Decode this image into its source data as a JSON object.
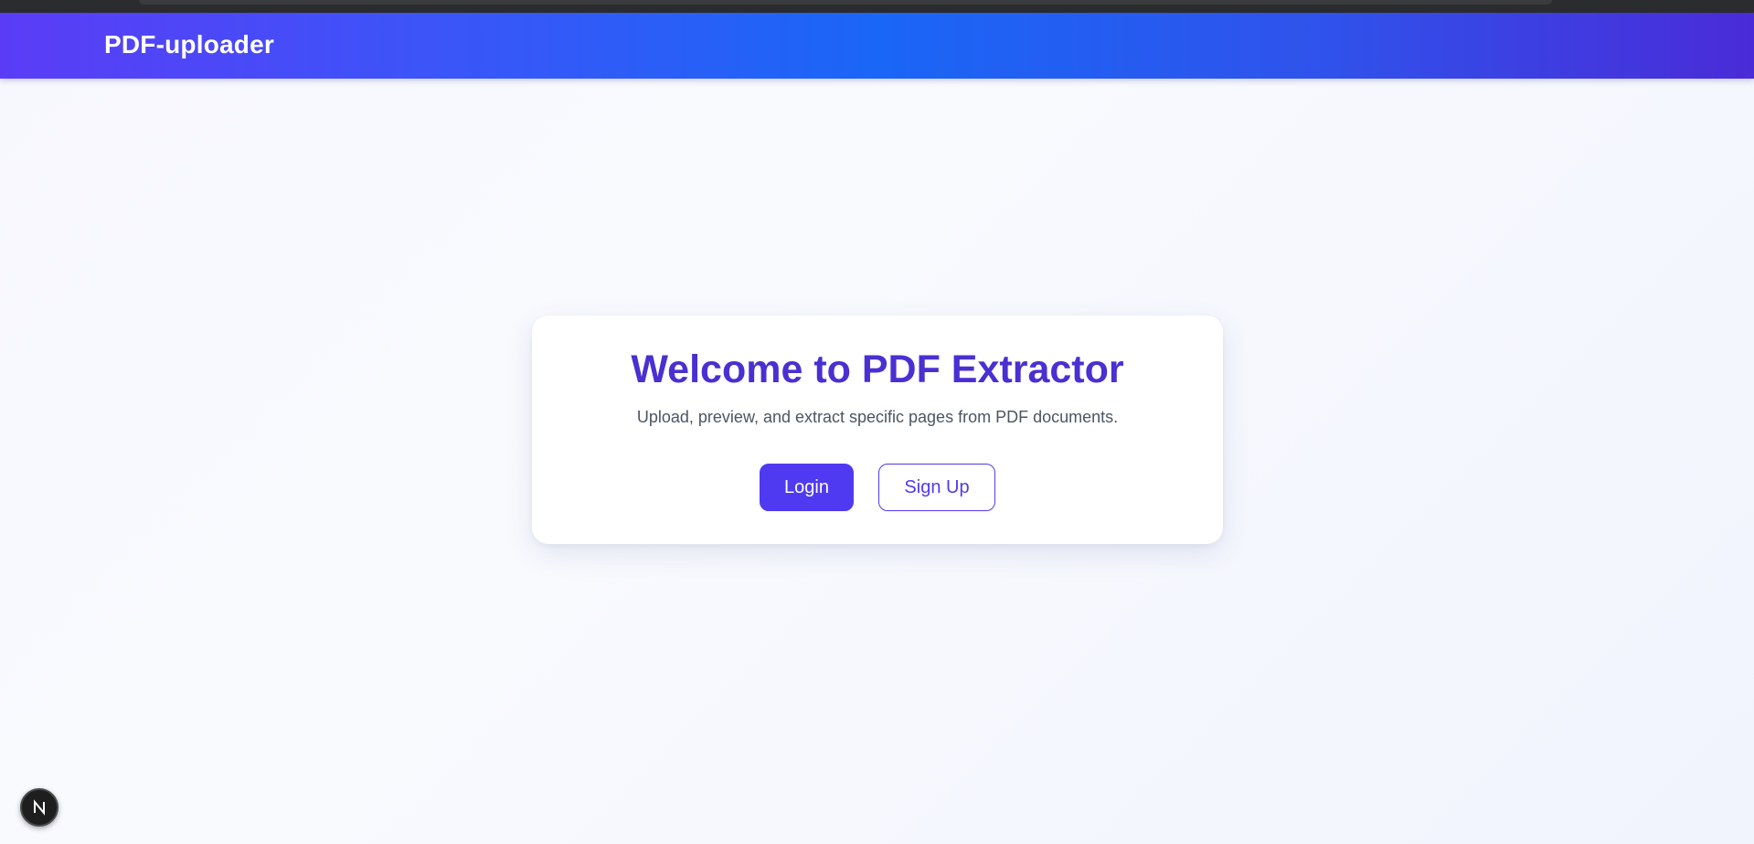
{
  "navbar": {
    "brand": "PDF-uploader"
  },
  "hero": {
    "title": "Welcome to PDF Extractor",
    "subtitle": "Upload, preview, and extract specific pages from PDF documents.",
    "login_label": "Login",
    "signup_label": "Sign Up"
  },
  "dev_badge": {
    "icon": "nextjs-n-icon"
  },
  "colors": {
    "accent": "#4f3af2",
    "title": "#4a2fd2",
    "navbar_start": "#5b3cf6",
    "navbar_mid": "#1a66f6",
    "navbar_end": "#4a2bd8"
  }
}
